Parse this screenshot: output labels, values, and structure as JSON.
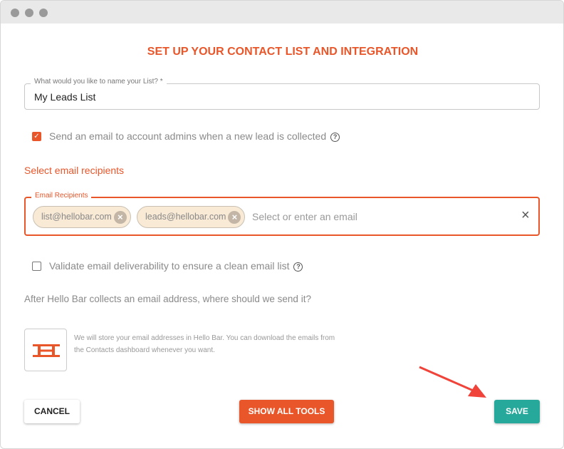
{
  "title": "SET UP YOUR CONTACT LIST AND INTEGRATION",
  "list_name": {
    "label": "What would you like to name your List? *",
    "value": "My Leads List"
  },
  "notify_admins": {
    "checked": true,
    "label": "Send an email to account admins when a new lead is collected"
  },
  "recipients_heading": "Select email recipients",
  "recipients": {
    "label": "Email Recipients",
    "chips": [
      "list@hellobar.com",
      "leads@hellobar.com"
    ],
    "placeholder": "Select or enter an email"
  },
  "validate": {
    "checked": false,
    "label": "Validate email deliverability to ensure a clean email list"
  },
  "question": "After Hello Bar collects an email address, where should we send it?",
  "storage": {
    "line1": "We will store your email addresses in Hello Bar. You can download the emails from",
    "line2": "the Contacts dashboard whenever you want."
  },
  "buttons": {
    "cancel": "CANCEL",
    "show_all": "SHOW ALL TOOLS",
    "save": "SAVE"
  },
  "colors": {
    "accent": "#e8562a",
    "save": "#26a99b",
    "arrow": "#f0433a"
  }
}
